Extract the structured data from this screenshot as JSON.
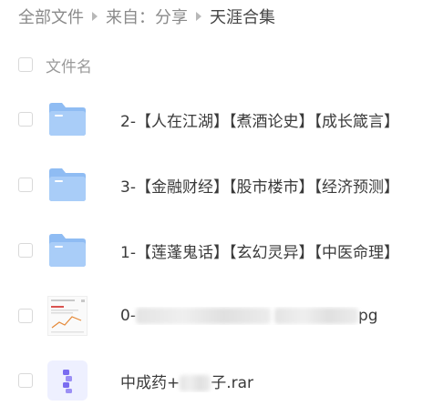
{
  "breadcrumb": {
    "items": [
      "全部文件",
      "来自：分享"
    ],
    "current": "天涯合集"
  },
  "list_header": {
    "label": "文件名"
  },
  "files": [
    {
      "name": "2-【人在江湖】【煮酒论史】【成长箴言】",
      "icon": "folder-icon"
    },
    {
      "name": "3-【金融财经】【股市楼市】【经济预测】",
      "icon": "folder-icon"
    },
    {
      "name": "1-【莲蓬鬼话】【玄幻灵异】【中医命理】",
      "icon": "folder-icon"
    },
    {
      "name_prefix": "0-",
      "name_suffix": "pg",
      "icon": "image-thumbnail"
    },
    {
      "name_prefix": "中成药+",
      "name_suffix": "子.rar",
      "icon": "archive-icon"
    }
  ],
  "colors": {
    "folder_body": "#a9cdf8",
    "folder_tab": "#8fbcf3",
    "archive_accent": "#7a6cf0"
  }
}
